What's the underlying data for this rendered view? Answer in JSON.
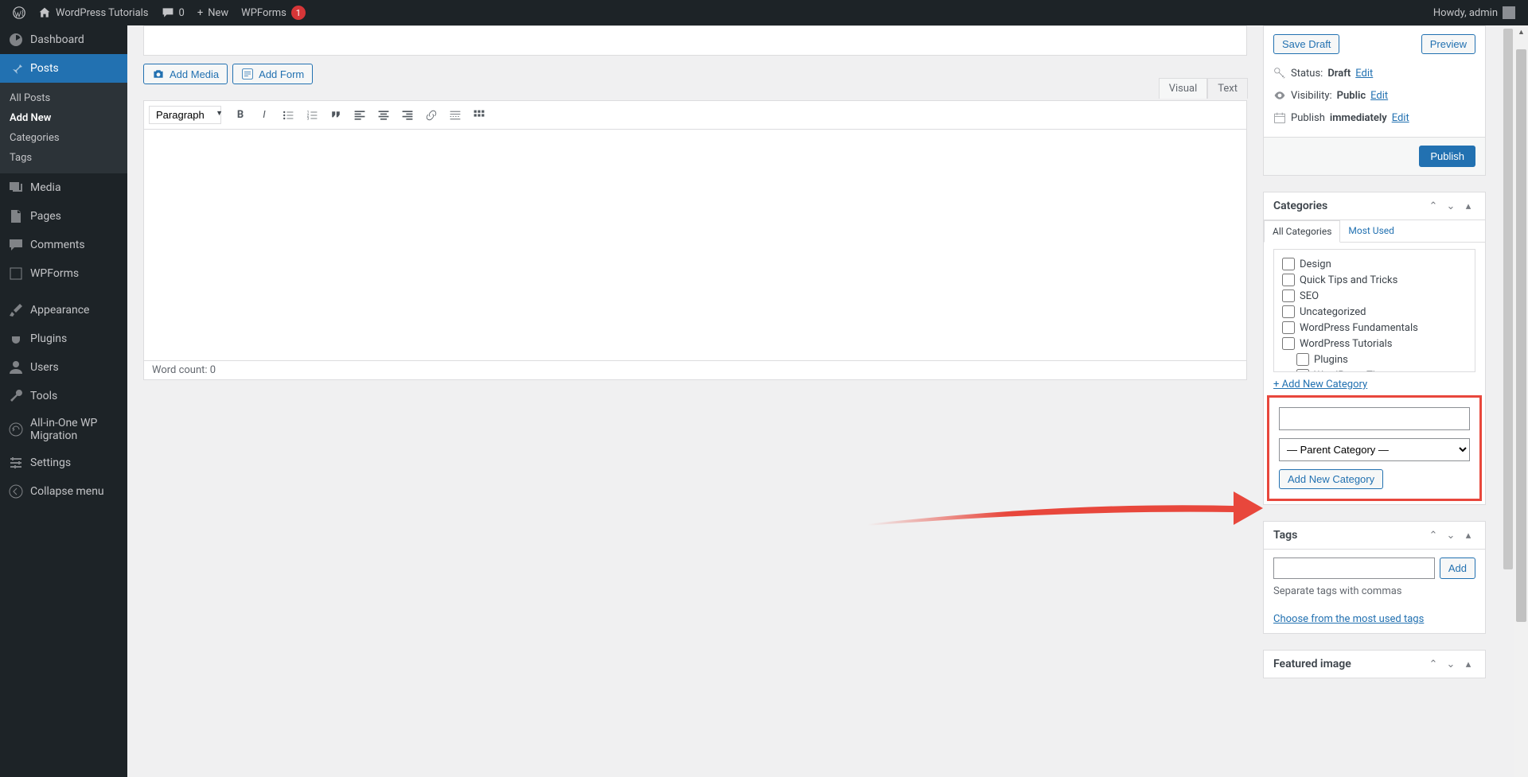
{
  "adminbar": {
    "site": "WordPress Tutorials",
    "comments": "0",
    "new": "New",
    "wpforms": "WPForms",
    "wpforms_badge": "1",
    "howdy": "Howdy, admin"
  },
  "nav": {
    "dashboard": "Dashboard",
    "posts": "Posts",
    "posts_sub": [
      "All Posts",
      "Add New",
      "Categories",
      "Tags"
    ],
    "media": "Media",
    "pages": "Pages",
    "comments": "Comments",
    "wpforms": "WPForms",
    "appearance": "Appearance",
    "plugins": "Plugins",
    "users": "Users",
    "tools": "Tools",
    "aio": "All-in-One WP Migration",
    "settings": "Settings",
    "collapse": "Collapse menu"
  },
  "editor": {
    "add_media": "Add Media",
    "add_form": "Add Form",
    "tab_visual": "Visual",
    "tab_text": "Text",
    "format": "Paragraph",
    "wordcount": "Word count: 0"
  },
  "publish": {
    "save_draft": "Save Draft",
    "preview": "Preview",
    "status_label": "Status:",
    "status_val": "Draft",
    "vis_label": "Visibility:",
    "vis_val": "Public",
    "sched_label": "Publish",
    "sched_val": "immediately",
    "edit": "Edit",
    "publish": "Publish"
  },
  "categories": {
    "title": "Categories",
    "tabs": [
      "All Categories",
      "Most Used"
    ],
    "items": [
      "Design",
      "Quick Tips and Tricks",
      "SEO",
      "Uncategorized",
      "WordPress Fundamentals",
      "WordPress Tutorials"
    ],
    "subitems": [
      "Plugins",
      "WordPress Themes"
    ],
    "add_link": "+ Add New Category",
    "parent_placeholder": "— Parent Category —",
    "add_btn": "Add New Category"
  },
  "tags": {
    "title": "Tags",
    "add": "Add",
    "hint": "Separate tags with commas",
    "choose": "Choose from the most used tags"
  },
  "featured": {
    "title": "Featured image"
  }
}
